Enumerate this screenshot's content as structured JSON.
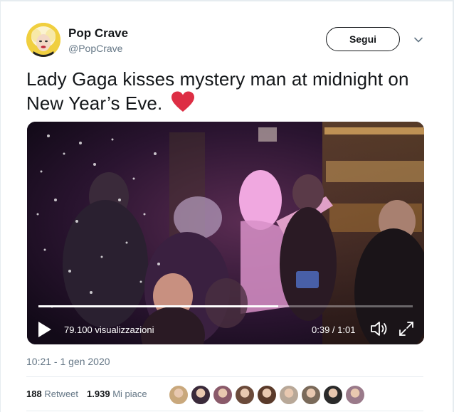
{
  "user": {
    "display_name": "Pop Crave",
    "handle": "@PopCrave"
  },
  "follow_button": {
    "label": "Segui"
  },
  "tweet": {
    "text": "Lady Gaga kisses mystery man at midnight on New Year’s Eve.",
    "emoji": "red-heart"
  },
  "video": {
    "views": "79.100 visualizzazioni",
    "time": "0:39 / 1:01",
    "progress": 0.64
  },
  "timestamp": "10:21 - 1 gen 2020",
  "stats": {
    "retweets_count": "188",
    "retweets_label": "Retweet",
    "likes_count": "1.939",
    "likes_label": "Mi piace"
  },
  "likers": [
    {
      "color": "#c9a87c"
    },
    {
      "color": "#3a2a3a"
    },
    {
      "color": "#8a5a6a"
    },
    {
      "color": "#6b4a3a"
    },
    {
      "color": "#5a3a2a"
    },
    {
      "color": "#b8a898"
    },
    {
      "color": "#7a6a5a"
    },
    {
      "color": "#2a2a2a"
    },
    {
      "color": "#9a7a8a"
    }
  ],
  "colors": {
    "text": "#14171a",
    "muted": "#657786",
    "divider": "#e6ecf0",
    "heart": "#dd2e44"
  }
}
